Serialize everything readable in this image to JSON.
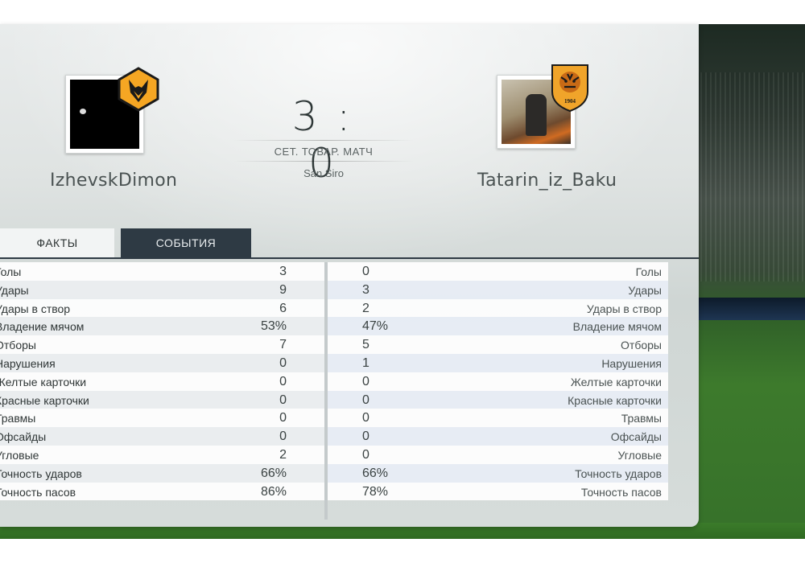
{
  "header": {
    "home_player": "IzhevskDimon",
    "away_player": "Tatarin_iz_Baku",
    "score": "3 : 0",
    "match_type": "СЕТ. ТОВАР. МАТЧ",
    "venue": "San Siro"
  },
  "badges": {
    "home": {
      "icon": "wolves-badge-icon",
      "color": "#f5a623"
    },
    "away": {
      "icon": "hull-tiger-badge-icon",
      "color": "#f0a42a",
      "text": "1904"
    }
  },
  "tabs": [
    {
      "label": "ФАКТЫ",
      "active": true
    },
    {
      "label": "СОБЫТИЯ",
      "active": false
    }
  ],
  "stats": [
    {
      "home_label": "Голы",
      "home": "3",
      "away": "0",
      "away_label": "Голы"
    },
    {
      "home_label": "Удары",
      "home": "9",
      "away": "3",
      "away_label": "Удары"
    },
    {
      "home_label": "Удары в створ",
      "home": "6",
      "away": "2",
      "away_label": "Удары в створ"
    },
    {
      "home_label": "Владение мячом",
      "home": "53%",
      "away": "47%",
      "away_label": "Владение мячом"
    },
    {
      "home_label": "Отборы",
      "home": "7",
      "away": "5",
      "away_label": "Отборы"
    },
    {
      "home_label": "Нарушения",
      "home": "0",
      "away": "1",
      "away_label": "Нарушения"
    },
    {
      "home_label": "Желтые карточки",
      "home": "0",
      "away": "0",
      "away_label": "Желтые карточки"
    },
    {
      "home_label": "Красные карточки",
      "home": "0",
      "away": "0",
      "away_label": "Красные карточки"
    },
    {
      "home_label": "Травмы",
      "home": "0",
      "away": "0",
      "away_label": "Травмы"
    },
    {
      "home_label": "Офсайды",
      "home": "0",
      "away": "0",
      "away_label": "Офсайды"
    },
    {
      "home_label": "Угловые",
      "home": "2",
      "away": "0",
      "away_label": "Угловые"
    },
    {
      "home_label": "Точность ударов",
      "home": "66%",
      "away": "66%",
      "away_label": "Точность ударов"
    },
    {
      "home_label": "Точность пасов",
      "home": "86%",
      "away": "78%",
      "away_label": "Точность пасов"
    }
  ],
  "colors": {
    "tab_active_bg": "#f2f4f4",
    "tab_dark_bg": "#2e3a44",
    "text": "#2f3636"
  }
}
